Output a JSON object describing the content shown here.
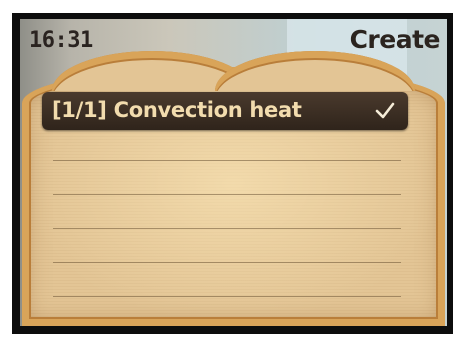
{
  "header": {
    "time": "16:31",
    "title": "Create"
  },
  "list": {
    "selected_item": {
      "label": "[1/1] Convection heat",
      "icon": "check-icon"
    },
    "empty_rows": 5
  },
  "colors": {
    "bezel": "#0d0d0d",
    "bread": "#e3c595",
    "crust": "#b97e3a",
    "selection_bg": "#3a2c21",
    "selection_text": "#f2dcae",
    "header_text": "#2b241f"
  }
}
